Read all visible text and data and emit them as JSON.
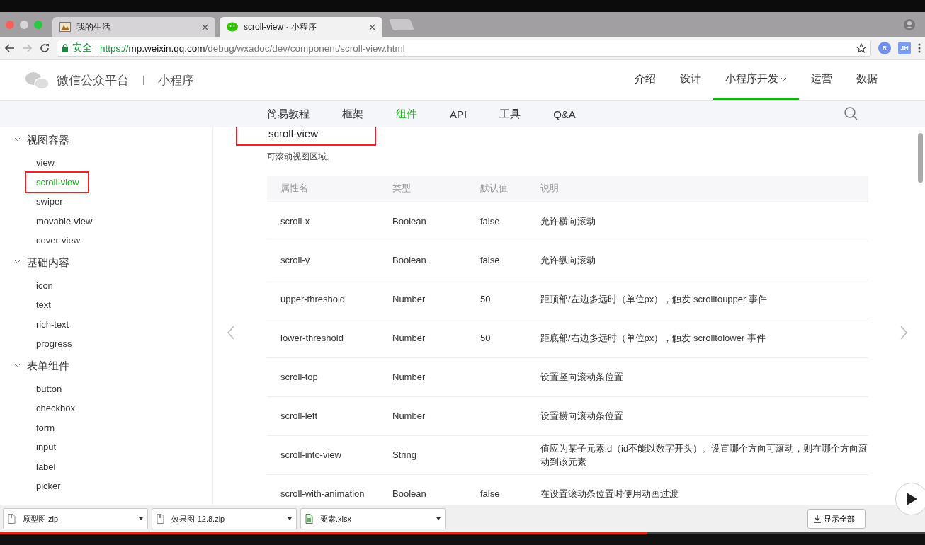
{
  "browser": {
    "tabs": [
      {
        "title": "我的生活",
        "selected": false,
        "kind": "picture"
      },
      {
        "title": "scroll-view · 小程序",
        "selected": true,
        "kind": "chat"
      }
    ],
    "address": {
      "secure_label": "安全",
      "scheme": "https://",
      "host": "mp.weixin.qq.com",
      "path": "/debug/wxadoc/dev/component/scroll-view.html"
    },
    "extensions": [
      "R",
      "JH"
    ]
  },
  "site_header": {
    "brand": "微信公众平台",
    "section": "小程序",
    "nav": [
      {
        "label": "介绍",
        "selected": false,
        "dropdown": false
      },
      {
        "label": "设计",
        "selected": false,
        "dropdown": false
      },
      {
        "label": "小程序开发",
        "selected": true,
        "dropdown": true
      },
      {
        "label": "运营",
        "selected": false,
        "dropdown": false
      },
      {
        "label": "数据",
        "selected": false,
        "dropdown": false
      }
    ]
  },
  "subnav": [
    {
      "label": "简易教程",
      "selected": false
    },
    {
      "label": "框架",
      "selected": false
    },
    {
      "label": "组件",
      "selected": true
    },
    {
      "label": "API",
      "selected": false
    },
    {
      "label": "工具",
      "selected": false
    },
    {
      "label": "Q&A",
      "selected": false
    }
  ],
  "sidebar": {
    "groups": [
      {
        "title": "视图容器",
        "expanded": true,
        "children": [
          {
            "label": "view",
            "selected": false,
            "highlighted": false
          },
          {
            "label": "scroll-view",
            "selected": true,
            "highlighted": true
          },
          {
            "label": "swiper",
            "selected": false,
            "highlighted": false
          },
          {
            "label": "movable-view",
            "selected": false,
            "highlighted": false
          },
          {
            "label": "cover-view",
            "selected": false,
            "highlighted": false
          }
        ]
      },
      {
        "title": "基础内容",
        "expanded": true,
        "children": [
          {
            "label": "icon",
            "selected": false,
            "highlighted": false
          },
          {
            "label": "text",
            "selected": false,
            "highlighted": false
          },
          {
            "label": "rich-text",
            "selected": false,
            "highlighted": false
          },
          {
            "label": "progress",
            "selected": false,
            "highlighted": false
          }
        ]
      },
      {
        "title": "表单组件",
        "expanded": true,
        "children": [
          {
            "label": "button",
            "selected": false,
            "highlighted": false
          },
          {
            "label": "checkbox",
            "selected": false,
            "highlighted": false
          },
          {
            "label": "form",
            "selected": false,
            "highlighted": false
          },
          {
            "label": "input",
            "selected": false,
            "highlighted": false
          },
          {
            "label": "label",
            "selected": false,
            "highlighted": false
          },
          {
            "label": "picker",
            "selected": false,
            "highlighted": false
          }
        ]
      }
    ]
  },
  "content": {
    "title": "scroll-view",
    "title_highlighted": true,
    "description": "可滚动视图区域。",
    "table": {
      "columns": [
        "属性名",
        "类型",
        "默认值",
        "说明"
      ],
      "rows": [
        [
          "scroll-x",
          "Boolean",
          "false",
          "允许横向滚动"
        ],
        [
          "scroll-y",
          "Boolean",
          "false",
          "允许纵向滚动"
        ],
        [
          "upper-threshold",
          "Number",
          "50",
          "距顶部/左边多远时（单位px），触发 scrolltoupper 事件"
        ],
        [
          "lower-threshold",
          "Number",
          "50",
          "距底部/右边多远时（单位px），触发 scrolltolower 事件"
        ],
        [
          "scroll-top",
          "Number",
          "",
          "设置竖向滚动条位置"
        ],
        [
          "scroll-left",
          "Number",
          "",
          "设置横向滚动条位置"
        ],
        [
          "scroll-into-view",
          "String",
          "",
          "值应为某子元素id（id不能以数字开头）。设置哪个方向可滚动，则在哪个方向滚动到该元素"
        ],
        [
          "scroll-with-animation",
          "Boolean",
          "false",
          "在设置滚动条位置时使用动画过渡"
        ]
      ]
    }
  },
  "downloads": {
    "items": [
      {
        "name": "原型图.zip",
        "kind": "archive"
      },
      {
        "name": "效果图-12.8.zip",
        "kind": "archive"
      },
      {
        "name": "要素.xlsx",
        "kind": "sheet"
      }
    ],
    "show_all": "显示全部"
  },
  "video": {
    "progress": {
      "level": 0.7
    }
  }
}
